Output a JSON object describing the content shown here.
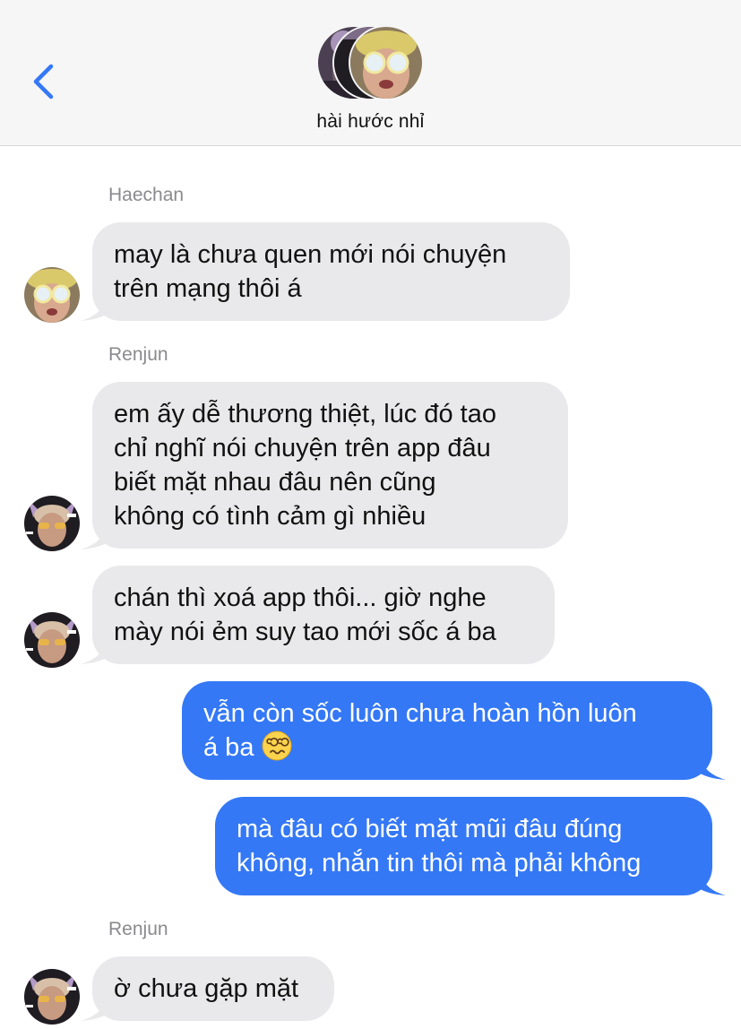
{
  "header": {
    "group_name": "hài hước nhỉ",
    "back_icon": "chevron-left-icon",
    "accent_color": "#3478f6"
  },
  "messages": [
    {
      "sender": "Haechan",
      "direction": "incoming",
      "text": "may là chưa quen mới nói chuyện\ntrên mạng thôi á"
    },
    {
      "sender": "Renjun",
      "direction": "incoming",
      "text": "em ấy dễ thương thiệt, lúc đó tao\nchỉ nghĩ nói chuyện trên app đâu\nbiết mặt nhau đâu nên cũng\nkhông có tình cảm gì nhiều"
    },
    {
      "sender": "",
      "direction": "incoming",
      "text": "chán thì xoá app thôi... giờ nghe\nmày nói ẻm suy tao mới sốc á ba"
    },
    {
      "sender": "",
      "direction": "outgoing",
      "text": "vẫn còn sốc luôn chưa hoàn hồn luôn\ná ba ",
      "emoji": "woozy-dizzy-face-icon"
    },
    {
      "sender": "",
      "direction": "outgoing",
      "text": "mà đâu có biết mặt mũi đâu đúng\nkhông, nhắn tin thôi mà phải không"
    },
    {
      "sender": "Renjun",
      "direction": "incoming",
      "text": "ờ chưa gặp mặt"
    }
  ],
  "colors": {
    "incoming_bubble": "#e9e9eb",
    "outgoing_bubble": "#3478f6",
    "sender_label": "#8a8a8e"
  }
}
